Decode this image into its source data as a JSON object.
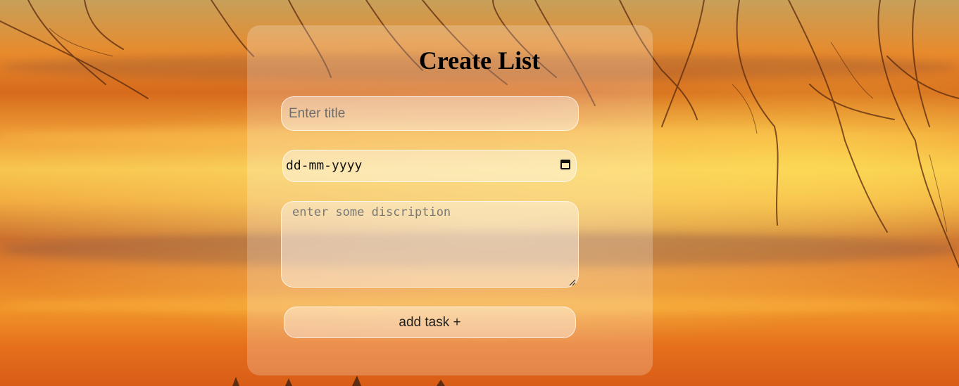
{
  "form": {
    "heading": "Create List",
    "title_placeholder": "Enter title",
    "date_placeholder": "dd-mm-yyyy",
    "description_placeholder": "enter some discription",
    "submit_label": "add task +"
  },
  "icons": {
    "date_picker": "calendar-icon",
    "textarea_resize": "resize-grip-icon"
  },
  "colors": {
    "sky_orange": "#e88a2c",
    "sky_yellow": "#f7c64e",
    "card_overlay": "rgba(255,255,255,0.22)"
  }
}
